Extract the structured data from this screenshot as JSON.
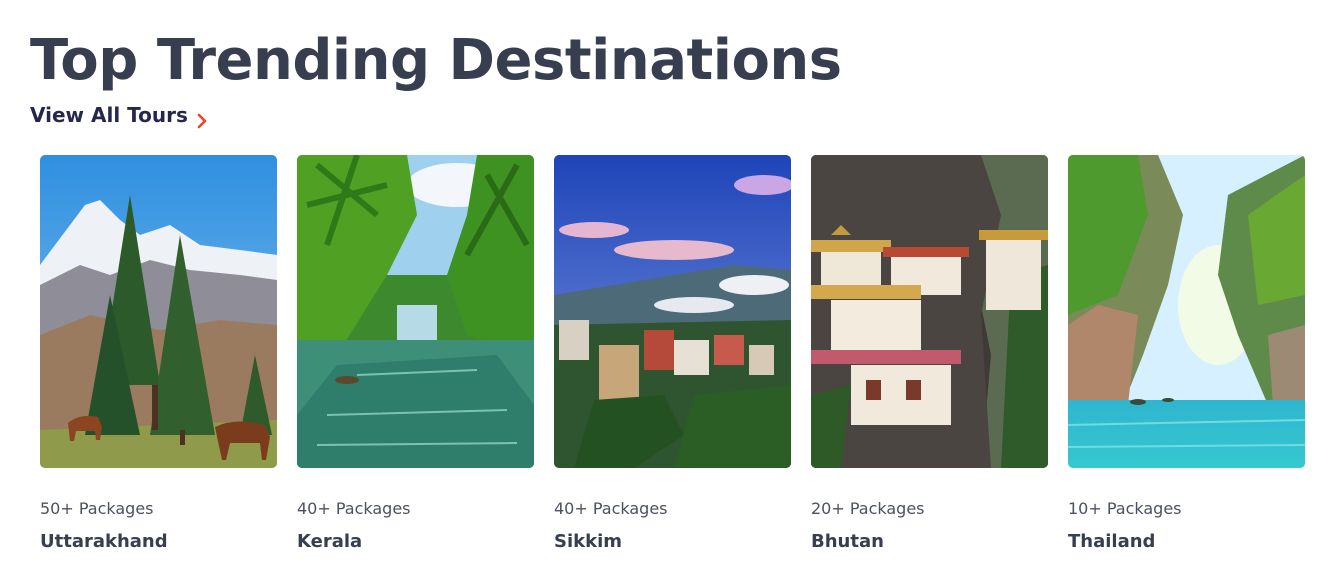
{
  "header": {
    "title": "Top Trending Destinations",
    "view_all_label": "View All Tours",
    "view_all_icon": "chevron-right-icon",
    "accent_color": "#e8462c"
  },
  "destinations": [
    {
      "packages": "50+ Packages",
      "name": "Uttarakhand",
      "image": "mountain-forest-horses-photo"
    },
    {
      "packages": "40+ Packages",
      "name": "Kerala",
      "image": "palm-backwater-photo"
    },
    {
      "packages": "40+ Packages",
      "name": "Sikkim",
      "image": "hill-town-clouds-photo"
    },
    {
      "packages": "20+ Packages",
      "name": "Bhutan",
      "image": "cliff-monastery-photo"
    },
    {
      "packages": "10+ Packages",
      "name": "Thailand",
      "image": "limestone-lagoon-photo"
    }
  ]
}
